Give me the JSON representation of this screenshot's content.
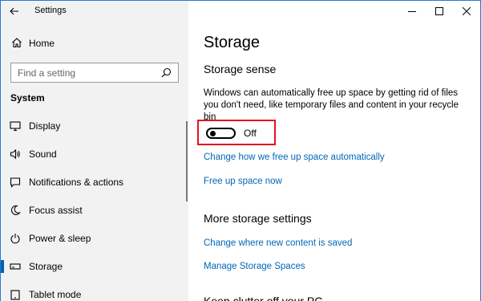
{
  "window": {
    "title": "Settings"
  },
  "sidebar": {
    "home_label": "Home",
    "search": {
      "placeholder": "Find a setting"
    },
    "section_title": "System",
    "items": [
      {
        "label": "Display",
        "icon": "monitor-icon"
      },
      {
        "label": "Sound",
        "icon": "speaker-icon"
      },
      {
        "label": "Notifications & actions",
        "icon": "notifications-icon"
      },
      {
        "label": "Focus assist",
        "icon": "moon-icon"
      },
      {
        "label": "Power & sleep",
        "icon": "power-icon"
      },
      {
        "label": "Storage",
        "icon": "storage-icon",
        "active": true
      },
      {
        "label": "Tablet mode",
        "icon": "tablet-icon"
      }
    ]
  },
  "main": {
    "title": "Storage",
    "storage_sense": {
      "heading": "Storage sense",
      "description": "Windows can automatically free up space by getting rid of files you don't need, like temporary files and content in your recycle bin",
      "toggle_state": "Off",
      "links": [
        "Change how we free up space automatically",
        "Free up space now"
      ]
    },
    "more_settings": {
      "heading": "More storage settings",
      "links": [
        "Change where new content is saved",
        "Manage Storage Spaces"
      ]
    },
    "next_heading": "Keep clutter off your PC"
  },
  "colors": {
    "accent": "#0067b8",
    "highlight_box": "#e2141d",
    "sidebar_bg": "#f2f2f2"
  }
}
